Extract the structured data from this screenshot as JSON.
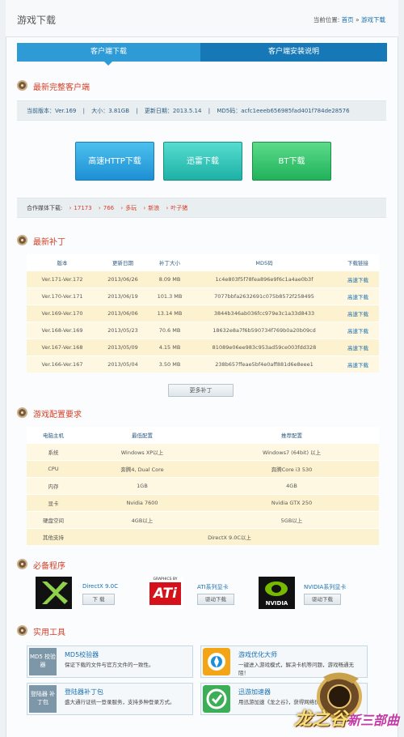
{
  "header": {
    "title": "游戏下载",
    "crumb_label": "当前位置:",
    "crumb_home": "首页",
    "crumb_sep": "»",
    "crumb_current": "游戏下载"
  },
  "tabs": [
    "客户端下载",
    "客户端安装说明"
  ],
  "client": {
    "section": "最新完整客户端",
    "version": "当前版本：Ver.169",
    "size": "大小：3.81GB",
    "date": "更新日期：2013.5.14",
    "md5": "MD5码：acfc1eeeb656985fad401f784de28576",
    "sep": "|",
    "buttons": {
      "http": "高速HTTP下载",
      "thunder": "迅雷下载",
      "bt": "BT下载"
    },
    "media_label": "合作媒体下载:",
    "media": [
      "17173",
      "766",
      "多玩",
      "新浪",
      "叶子猪"
    ]
  },
  "patch": {
    "section": "最新补丁",
    "headers": [
      "版本",
      "更新日期",
      "补丁大小",
      "MD5码",
      "下载链接"
    ],
    "rows": [
      [
        "Ver.171-Ver.172",
        "2013/06/26",
        "8.09 MB",
        "1c4e803f5f78fea896e9f6c1a4ae0b3f",
        "高速下载"
      ],
      [
        "Ver.170-Ver.171",
        "2013/06/19",
        "101.3 MB",
        "7077bbfa2632691c075b8572f258495",
        "高速下载"
      ],
      [
        "Ver.169-Ver.170",
        "2013/06/06",
        "13.14 MB",
        "3844b346ab036fcc979e3c1a33d8433",
        "高速下载"
      ],
      [
        "Ver.168-Ver.169",
        "2013/05/23",
        "70.6 MB",
        "18632e8a7f6b590734f769b0a20b09cd",
        "高速下载"
      ],
      [
        "Ver.167-Ver.168",
        "2013/05/09",
        "4.15 MB",
        "81089e06ee983c953ad59ce003fdd328",
        "高速下载"
      ],
      [
        "Ver.166-Ver.167",
        "2013/05/04",
        "3.50 MB",
        "238b657ffeae5bf4e0aff881d6e8eee1",
        "高速下载"
      ]
    ],
    "more": "更多补丁"
  },
  "config": {
    "section": "游戏配置要求",
    "headers": [
      "电脑主机",
      "最低配置",
      "推荐配置"
    ],
    "rows": [
      [
        "系统",
        "Windows XP以上",
        "Windows7 (64bit) 以上"
      ],
      [
        "CPU",
        "奔腾4, Dual Core",
        "奔腾Core i3 530"
      ],
      [
        "内存",
        "1GB",
        "4GB"
      ],
      [
        "显卡",
        "Nvidia 7600",
        "Nvidia GTX 250"
      ],
      [
        "硬盘空间",
        "4GB以上",
        "5GB以上"
      ]
    ],
    "other_label": "其他支持",
    "other_value": "DirectX 9.0C以上"
  },
  "programs": {
    "section": "必备程序",
    "items": [
      {
        "name": "DirectX 9.0C",
        "button": "下 载"
      },
      {
        "name": "ATI系列显卡",
        "button": "驱动下载",
        "logo_top": "GRAPHICS BY",
        "logo_text": "ATi"
      },
      {
        "name": "NVIDIA系列显卡",
        "button": "驱动下载",
        "logo_text": "NVIDIA"
      }
    ]
  },
  "tools": {
    "section": "实用工具",
    "items": [
      {
        "logo": "MD5 校验器",
        "name": "MD5校验器",
        "desc": "保证下载的文件与官方文件的一致性。"
      },
      {
        "name": "游戏优化大师",
        "desc": "一键进入游戏模式，解决卡机等问题，游戏畅通无阻！"
      },
      {
        "logo": "登陆器 补丁包",
        "name": "登陆器补丁包",
        "desc": "盛大通行证统一登录服务，支持多种登录方式。"
      },
      {
        "name": "迅游加速器",
        "desc": "用迅游加速《龙之谷》，获得网络优化..."
      }
    ]
  },
  "brand": {
    "name": "龙之谷",
    "sub": "新三部曲"
  },
  "colors": {
    "accent": "#1a83c6",
    "section_title": "#d4412a",
    "row_odd": "#fdf2cf",
    "row_even": "#fef8e2"
  }
}
